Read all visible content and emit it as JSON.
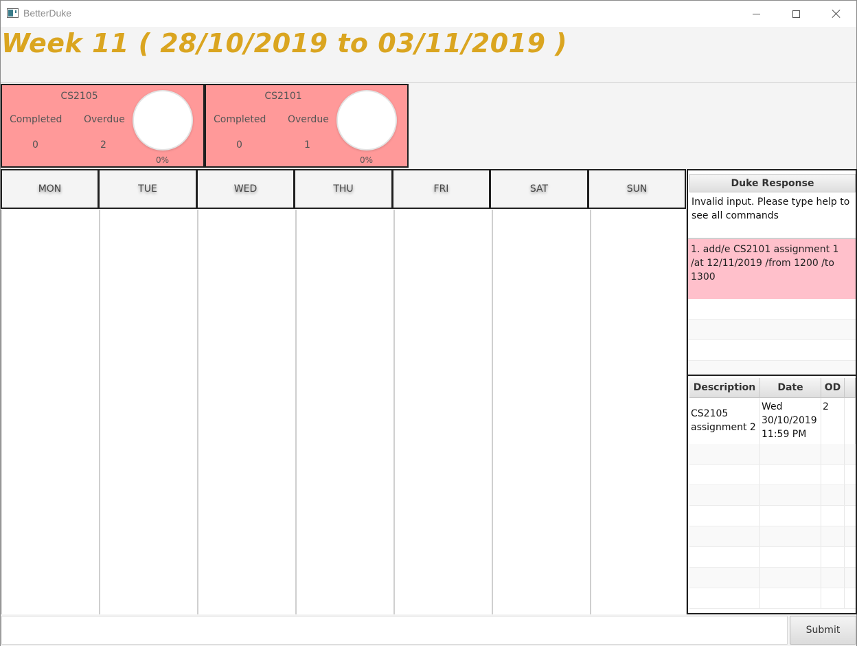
{
  "window": {
    "title": "BetterDuke"
  },
  "week": {
    "title": "Week 11 ( 28/10/2019 to 03/11/2019 )"
  },
  "modules": [
    {
      "code": "CS2105",
      "completed_label": "Completed",
      "overdue_label": "Overdue",
      "completed": "0",
      "overdue": "2",
      "progress_label": "0%",
      "progress": 0
    },
    {
      "code": "CS2101",
      "completed_label": "Completed",
      "overdue_label": "Overdue",
      "completed": "0",
      "overdue": "1",
      "progress_label": "0%",
      "progress": 0
    }
  ],
  "days": [
    "MON",
    "TUE",
    "WED",
    "THU",
    "FRI",
    "SAT",
    "SUN"
  ],
  "duke": {
    "header": "Duke Response",
    "response": "Invalid input. Please type help to see all commands",
    "commands": [
      "1.  add/e CS2101 assignment 1 /at 12/11/2019 /from 1200 /to 1300"
    ]
  },
  "task_table": {
    "columns": [
      "Description",
      "Date",
      "OD"
    ],
    "rows": [
      {
        "description": "CS2105 assignment 2",
        "date": "Wed 30/10/2019 11:59 PM",
        "od": "2"
      }
    ]
  },
  "command_bar": {
    "input_value": "",
    "submit_label": "Submit"
  },
  "colors": {
    "title": "#daa520",
    "module_card": "#ff9999",
    "command_item": "#ffc0cb"
  }
}
